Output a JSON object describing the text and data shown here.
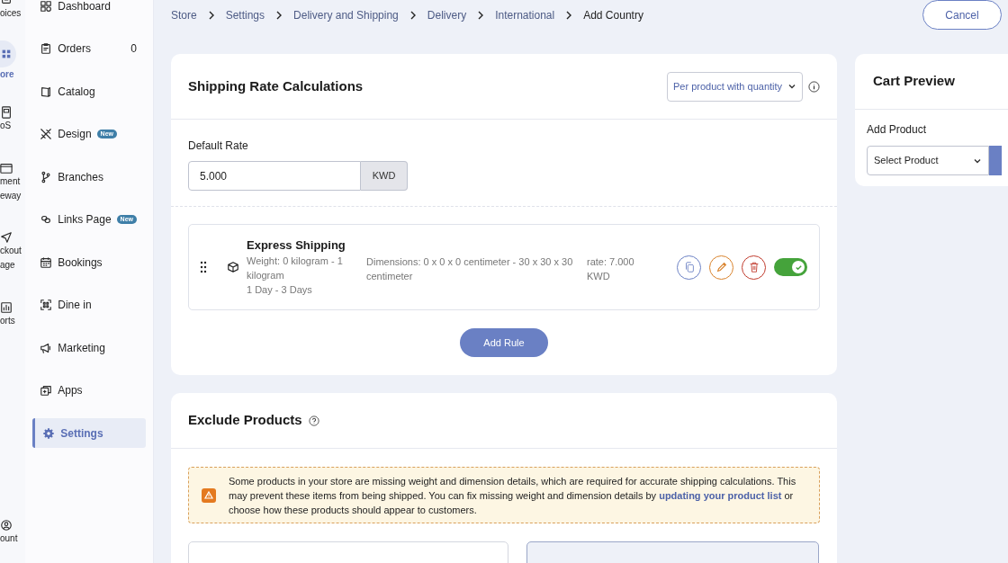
{
  "rail": [
    {
      "lines": [
        "oices"
      ],
      "selected": false
    },
    {
      "lines": [
        "ore"
      ],
      "selected": true
    },
    {
      "lines": [
        "oS"
      ],
      "selected": false
    },
    {
      "lines": [
        "ment",
        "eway"
      ],
      "selected": false
    },
    {
      "lines": [
        "ckout",
        "age"
      ],
      "selected": false
    },
    {
      "lines": [
        "orts"
      ],
      "selected": false
    }
  ],
  "rail_bottom": {
    "lines": [
      "ount"
    ]
  },
  "sidebar": {
    "items": [
      {
        "label": "Dashboard",
        "selected": false
      },
      {
        "label": "Orders",
        "count": "0",
        "selected": false
      },
      {
        "label": "Catalog",
        "selected": false
      },
      {
        "label": "Design",
        "badge": "New",
        "selected": false
      },
      {
        "label": "Branches",
        "selected": false
      },
      {
        "label": "Links Page",
        "badge": "New",
        "selected": false
      },
      {
        "label": "Bookings",
        "selected": false
      },
      {
        "label": "Dine in",
        "selected": false
      },
      {
        "label": "Marketing",
        "selected": false
      },
      {
        "label": "Apps",
        "selected": false
      },
      {
        "label": "Settings",
        "selected": true
      }
    ]
  },
  "breadcrumb": [
    "Store",
    "Settings",
    "Delivery and Shipping",
    "Delivery",
    "International",
    "Add Country"
  ],
  "cancel_button": "Cancel",
  "shipping_rates": {
    "title": "Shipping Rate Calculations",
    "method": "Per product with quantity",
    "default_rate_label": "Default Rate",
    "default_rate": "5.000",
    "currency": "KWD",
    "rules": [
      {
        "name": "Express Shipping",
        "weight": "Weight: 0 kilogram - 1 kilogram",
        "duration": "1 Day - 3 Days",
        "dimensions": "Dimensions: 0 x 0 x 0 centimeter - 30 x 30 x 30 centimeter",
        "rate": "rate: 7.000 KWD",
        "enabled": true
      }
    ],
    "add_rule_button": "Add Rule"
  },
  "exclude_products": {
    "title": "Exclude Products",
    "warning": "Some products in your store are missing weight and dimension details, which are required for accurate shipping calculations. This may prevent these items from being shipped. You can fix missing weight and dimension details by ",
    "warning_link": "updating your product list",
    "warning_end": " or choose how these products should appear to customers."
  },
  "cart_preview": {
    "title": "Cart Preview",
    "add_product_label": "Add Product",
    "select_placeholder": "Select Product"
  }
}
